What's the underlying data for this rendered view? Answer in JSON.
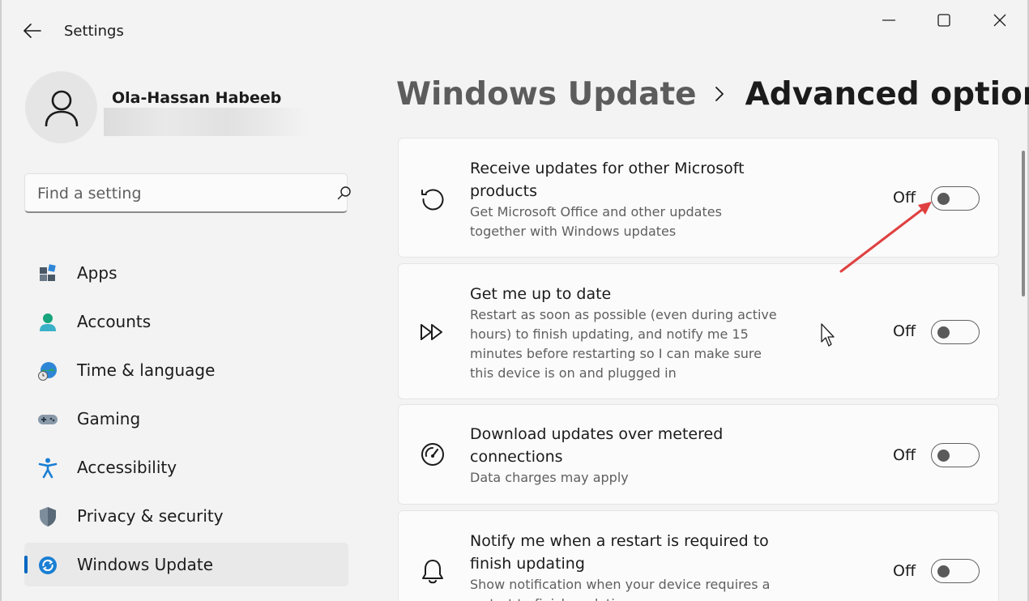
{
  "window": {
    "title": "Settings"
  },
  "profile": {
    "name": "Ola-Hassan Habeeb"
  },
  "search": {
    "placeholder": "Find a setting"
  },
  "nav": {
    "items": [
      {
        "label": "Apps",
        "icon": "apps-icon"
      },
      {
        "label": "Accounts",
        "icon": "accounts-icon"
      },
      {
        "label": "Time & language",
        "icon": "time-language-icon"
      },
      {
        "label": "Gaming",
        "icon": "gaming-icon"
      },
      {
        "label": "Accessibility",
        "icon": "accessibility-icon"
      },
      {
        "label": "Privacy & security",
        "icon": "shield-icon"
      },
      {
        "label": "Windows Update",
        "icon": "windows-update-icon",
        "active": true
      }
    ]
  },
  "header": {
    "parent": "Windows Update",
    "current": "Advanced options"
  },
  "options": [
    {
      "title": "Receive updates for other Microsoft products",
      "description": "Get Microsoft Office and other updates together with Windows updates",
      "state_label": "Off",
      "enabled": false,
      "icon": "refresh-icon"
    },
    {
      "title": "Get me up to date",
      "description": "Restart as soon as possible (even during active hours) to finish updating, and notify me 15 minutes before restarting so I can make sure this device is on and plugged in",
      "state_label": "Off",
      "enabled": false,
      "icon": "fast-forward-icon"
    },
    {
      "title": "Download updates over metered connections",
      "description": "Data charges may apply",
      "state_label": "Off",
      "enabled": false,
      "icon": "speedometer-icon"
    },
    {
      "title": "Notify me when a restart is required to finish updating",
      "description": "Show notification when your device requires a restart to finish updating",
      "state_label": "Off",
      "enabled": false,
      "icon": "bell-icon"
    }
  ],
  "colors": {
    "accent": "#0067c0",
    "annotation_arrow": "#e04040"
  }
}
